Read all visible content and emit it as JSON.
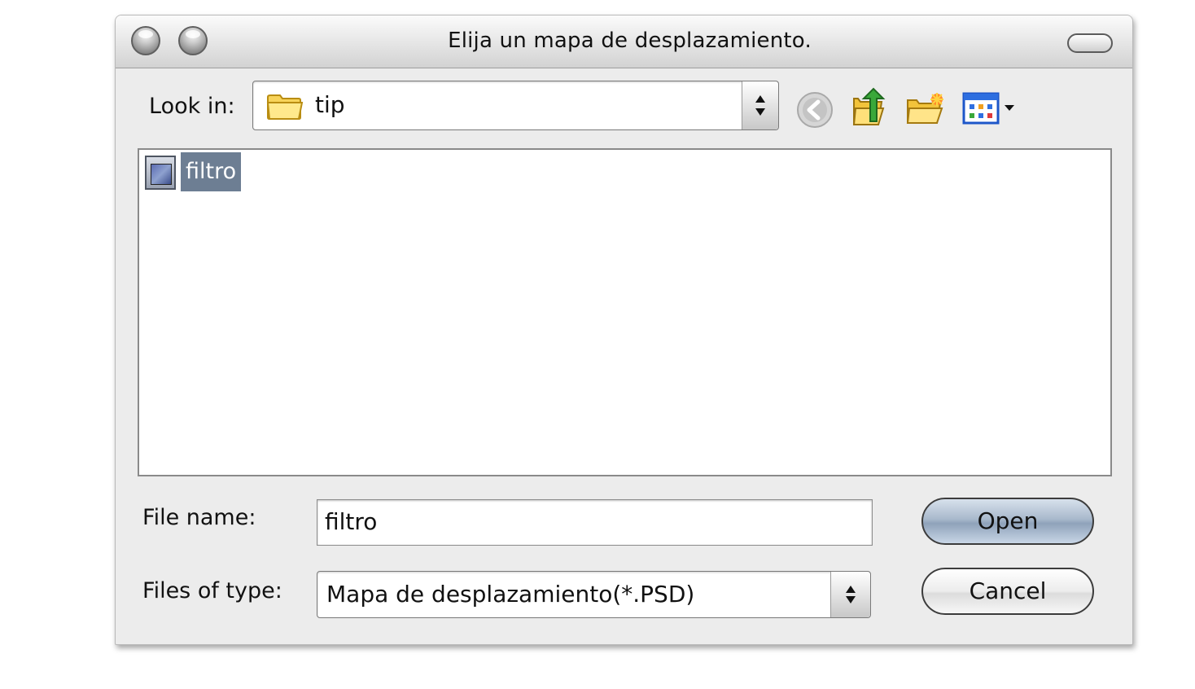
{
  "window": {
    "title": "Elija un mapa de desplazamiento."
  },
  "look_in": {
    "label": "Look in:",
    "value": "tip"
  },
  "toolbar": {
    "icons": [
      "back-icon",
      "up-folder-icon",
      "new-folder-icon",
      "view-menu-icon"
    ]
  },
  "files": [
    {
      "name": "filtro",
      "selected": true
    }
  ],
  "file_name": {
    "label": "File name:",
    "value": "filtro"
  },
  "file_type": {
    "label": "Files of type:",
    "value": "Mapa de desplazamiento(*.PSD)"
  },
  "buttons": {
    "open": "Open",
    "cancel": "Cancel"
  },
  "colors": {
    "selection": "#6d7e93",
    "open_button": "#a9b9cc"
  }
}
